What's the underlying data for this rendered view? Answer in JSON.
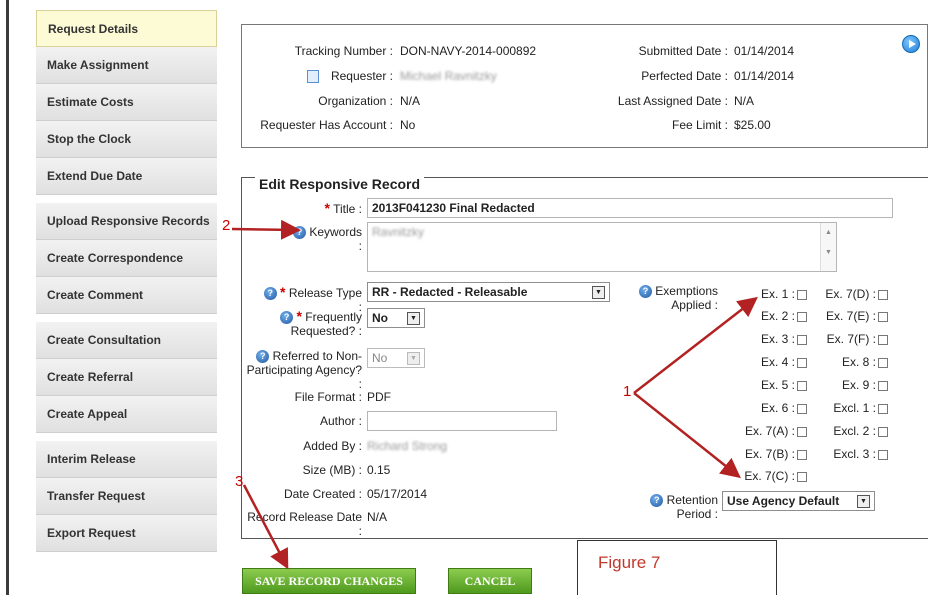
{
  "sidebar": {
    "items": [
      {
        "label": "Request Details"
      },
      {
        "label": "Make Assignment"
      },
      {
        "label": "Estimate Costs"
      },
      {
        "label": "Stop the Clock"
      },
      {
        "label": "Extend Due Date"
      },
      {
        "label": "Upload Responsive Records"
      },
      {
        "label": "Create Correspondence"
      },
      {
        "label": "Create Comment"
      },
      {
        "label": "Create Consultation"
      },
      {
        "label": "Create Referral"
      },
      {
        "label": "Create Appeal"
      },
      {
        "label": "Interim Release"
      },
      {
        "label": "Transfer Request"
      },
      {
        "label": "Export Request"
      }
    ]
  },
  "summary": {
    "tracking_label": "Tracking Number :",
    "tracking_value": "DON-NAVY-2014-000892",
    "requester_label": "Requester :",
    "requester_value": "Michael Ravnitzky",
    "organization_label": "Organization :",
    "organization_value": "N/A",
    "account_label": "Requester Has Account :",
    "account_value": "No",
    "submitted_label": "Submitted Date :",
    "submitted_value": "01/14/2014",
    "perfected_label": "Perfected Date :",
    "perfected_value": "01/14/2014",
    "assigned_label": "Last Assigned Date :",
    "assigned_value": "N/A",
    "fee_label": "Fee Limit :",
    "fee_value": "$25.00"
  },
  "form": {
    "legend": "Edit Responsive Record",
    "title_label": "Title :",
    "title_value": "2013F041230 Final Redacted",
    "keywords_label": "Keywords :",
    "keywords_value": "Ravnitzky",
    "release_type_label": "Release Type :",
    "release_type_value": "RR - Redacted - Releasable",
    "freq_label_1": "Frequently",
    "freq_label_2": "Requested? :",
    "freq_value": "No",
    "referred_label_1": "Referred to Non-",
    "referred_label_2": "Participating Agency? :",
    "referred_value": "No",
    "file_format_label": "File Format :",
    "file_format_value": "PDF",
    "author_label": "Author :",
    "author_value": "",
    "added_by_label": "Added By :",
    "added_by_value": "Richard Strong",
    "size_label": "Size (MB) :",
    "size_value": "0.15",
    "date_created_label": "Date Created :",
    "date_created_value": "05/17/2014",
    "release_date_label": "Record Release Date :",
    "release_date_value": "N/A",
    "exemptions_label_1": "Exemptions",
    "exemptions_label_2": "Applied :",
    "exemptions_col1": [
      "Ex. 1 :",
      "Ex. 2 :",
      "Ex. 3 :",
      "Ex. 4 :",
      "Ex. 5 :",
      "Ex. 6 :",
      "Ex. 7(A) :",
      "Ex. 7(B) :",
      "Ex. 7(C) :"
    ],
    "exemptions_col2": [
      "Ex. 7(D) :",
      "Ex. 7(E) :",
      "Ex. 7(F) :",
      "Ex. 8 :",
      "Ex. 9 :",
      "Excl. 1 :",
      "Excl. 2 :",
      "Excl. 3 :"
    ],
    "retention_label_1": "Retention",
    "retention_label_2": "Period :",
    "retention_value": "Use Agency Default"
  },
  "buttons": {
    "save": "SAVE RECORD CHANGES",
    "cancel": "CANCEL"
  },
  "annotations": {
    "figure_caption": "Figure 7",
    "n1": "1",
    "n2": "2",
    "n3": "3"
  },
  "colors": {
    "annotation_red": "#c0392b",
    "button_green": "#5aa526",
    "sidebar_active": "#fdfbd6"
  }
}
